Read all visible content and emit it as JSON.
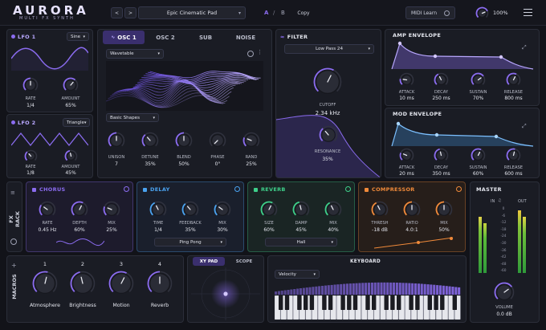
{
  "header": {
    "logo": "AURORA",
    "subtitle": "MULTI FX SYNTH",
    "preset_prev": "<",
    "preset_next": ">",
    "preset_name": "Epic Cinematic Pad",
    "ab_a": "A",
    "ab_sep": "/",
    "ab_b": "B",
    "copy": "Copy",
    "midi_learn": "MIDI Learn",
    "volume_pct": "100%"
  },
  "lfo1": {
    "title": "LFO 1",
    "shape": "Sine",
    "rate_label": "RATE",
    "rate_value": "1/4",
    "amount_label": "AMOUNT",
    "amount_value": "65%",
    "amount_level": 0.65
  },
  "lfo2": {
    "title": "LFO 2",
    "shape": "Triangle",
    "rate_label": "RATE",
    "rate_value": "1/8",
    "amount_label": "AMOUNT",
    "amount_value": "45%",
    "amount_level": 0.45
  },
  "osc": {
    "tabs": [
      "OSC 1",
      "OSC 2",
      "SUB",
      "NOISE"
    ],
    "type": "Wavetable",
    "table": "Basic Shapes",
    "knobs": [
      {
        "label": "UNISON",
        "value": "7",
        "level": 0.5
      },
      {
        "label": "DETUNE",
        "value": "35%",
        "level": 0.35
      },
      {
        "label": "BLEND",
        "value": "50%",
        "level": 0.5
      },
      {
        "label": "PHASE",
        "value": "0°",
        "level": 0.0
      },
      {
        "label": "RAND",
        "value": "25%",
        "level": 0.25
      }
    ]
  },
  "filter": {
    "title": "FILTER",
    "type": "Low Pass 24",
    "cutoff_label": "CUTOFF",
    "cutoff_value": "2.34 kHz",
    "cutoff_level": 0.6,
    "res_label": "RESONANCE",
    "res_value": "35%",
    "res_level": 0.35
  },
  "amp_env": {
    "title": "AMP ENVELOPE",
    "knobs": [
      {
        "label": "ATTACK",
        "value": "10 ms",
        "level": 0.2
      },
      {
        "label": "DECAY",
        "value": "250 ms",
        "level": 0.4
      },
      {
        "label": "SUSTAIN",
        "value": "70%",
        "level": 0.7
      },
      {
        "label": "RELEASE",
        "value": "800 ms",
        "level": 0.6
      }
    ]
  },
  "mod_env": {
    "title": "MOD ENVELOPE",
    "knobs": [
      {
        "label": "ATTACK",
        "value": "20 ms",
        "level": 0.25
      },
      {
        "label": "DECAY",
        "value": "350 ms",
        "level": 0.45
      },
      {
        "label": "SUSTAIN",
        "value": "60%",
        "level": 0.6
      },
      {
        "label": "RELEASE",
        "value": "600 ms",
        "level": 0.55
      }
    ]
  },
  "fx_rack_label": "FX RACK",
  "chorus": {
    "title": "CHORUS",
    "color": "#8b6cf0",
    "knobs": [
      {
        "label": "RATE",
        "value": "0.45 Hz",
        "level": 0.3
      },
      {
        "label": "DEPTH",
        "value": "60%",
        "level": 0.6
      },
      {
        "label": "MIX",
        "value": "25%",
        "level": 0.25
      }
    ]
  },
  "delay": {
    "title": "DELAY",
    "color": "#4aa3f0",
    "mode": "Ping Pong",
    "knobs": [
      {
        "label": "TIME",
        "value": "1/4",
        "level": 0.4
      },
      {
        "label": "FEEDBACK",
        "value": "35%",
        "level": 0.35
      },
      {
        "label": "MIX",
        "value": "30%",
        "level": 0.3
      }
    ]
  },
  "reverb": {
    "title": "REVERB",
    "color": "#3ed08a",
    "mode": "Hall",
    "knobs": [
      {
        "label": "SIZE",
        "value": "60%",
        "level": 0.6
      },
      {
        "label": "DAMP",
        "value": "45%",
        "level": 0.45
      },
      {
        "label": "MIX",
        "value": "40%",
        "level": 0.4
      }
    ]
  },
  "compressor": {
    "title": "COMPRESSOR",
    "color": "#f08a3a",
    "knobs": [
      {
        "label": "THRESH",
        "value": "-18 dB",
        "level": 0.4
      },
      {
        "label": "RATIO",
        "value": "4.0:1",
        "level": 0.5
      },
      {
        "label": "MIX",
        "value": "50%",
        "level": 0.5
      }
    ]
  },
  "master": {
    "title": "MASTER",
    "in_label": "IN",
    "out_label": "OUT",
    "scale": [
      "0",
      "-6",
      "-12",
      "-18",
      "-24",
      "-30",
      "-36",
      "-42",
      "-48",
      "-60"
    ],
    "volume_label": "VOLUME",
    "volume_value": "0.0 dB",
    "volume_level": 0.7
  },
  "macros": {
    "label": "MACROS",
    "items": [
      {
        "num": "1",
        "name": "Atmosphere",
        "level": 0.55
      },
      {
        "num": "2",
        "name": "Brightness",
        "level": 0.45
      },
      {
        "num": "3",
        "name": "Motion",
        "level": 0.6
      },
      {
        "num": "4",
        "name": "Reverb",
        "level": 0.5
      }
    ]
  },
  "xypad": {
    "tab1": "XY PAD",
    "tab2": "SCOPE"
  },
  "keyboard": {
    "title": "KEYBOARD",
    "mode": "Velocity"
  },
  "colors": {
    "accent": "#8b6cf0",
    "delay": "#4aa3f0",
    "reverb": "#3ed08a",
    "compressor": "#f08a3a",
    "mod_env": "#4aa3f0"
  }
}
